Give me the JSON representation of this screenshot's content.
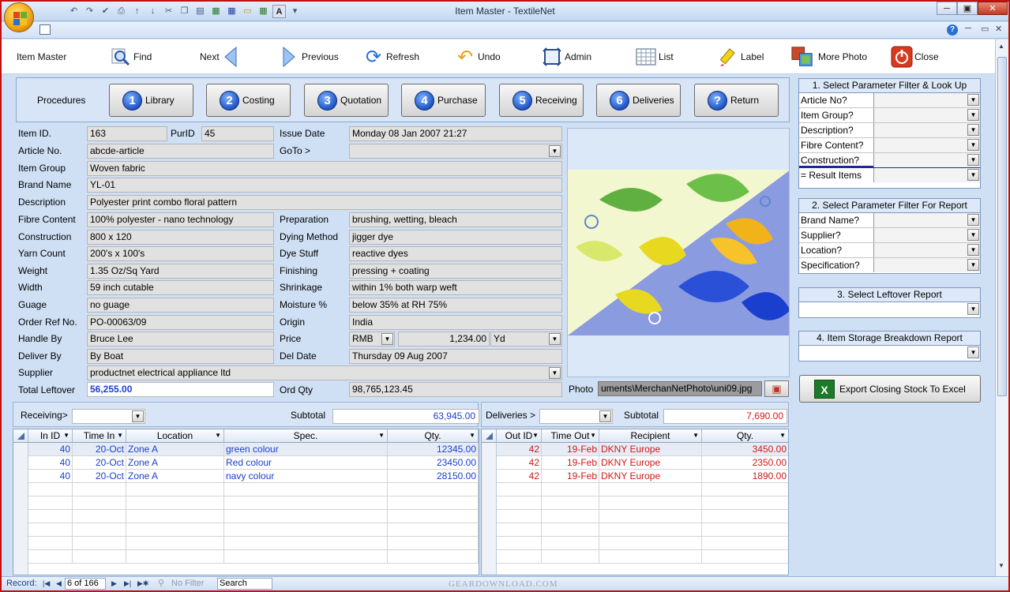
{
  "window": {
    "title": "Item Master - TextileNet",
    "help_icon": "?",
    "min": "─",
    "max": "▣",
    "close": "✕"
  },
  "toolbar": {
    "form_title": "Item Master",
    "find": "Find",
    "next": "Next",
    "previous": "Previous",
    "refresh": "Refresh",
    "undo": "Undo",
    "admin": "Admin",
    "list": "List",
    "label": "Label",
    "more_photo": "More Photo",
    "close": "Close"
  },
  "procedures": {
    "label": "Procedures",
    "buttons": [
      {
        "num": "1",
        "label": "Library"
      },
      {
        "num": "2",
        "label": "Costing"
      },
      {
        "num": "3",
        "label": "Quotation"
      },
      {
        "num": "4",
        "label": "Purchase"
      },
      {
        "num": "5",
        "label": "Receiving"
      },
      {
        "num": "6",
        "label": "Deliveries"
      },
      {
        "num": "?",
        "label": "Return"
      }
    ]
  },
  "form": {
    "item_id": {
      "label": "Item ID.",
      "value": "163"
    },
    "purid": {
      "label": "PurID",
      "value": "45"
    },
    "issue_date": {
      "label": "Issue Date",
      "value": "Monday 08 Jan 2007 21:27"
    },
    "article_no": {
      "label": "Article No.",
      "value": "abcde-article"
    },
    "goto": {
      "label": "GoTo >",
      "value": ""
    },
    "item_group": {
      "label": "Item Group",
      "value": "Woven fabric"
    },
    "brand_name": {
      "label": "Brand Name",
      "value": "YL-01"
    },
    "description": {
      "label": "Description",
      "value": "Polyester print combo floral pattern"
    },
    "fibre_content": {
      "label": "Fibre Content",
      "value": "100% polyester - nano technology"
    },
    "preparation": {
      "label": "Preparation",
      "value": "brushing, wetting, bleach"
    },
    "construction": {
      "label": "Construction",
      "value": "800 x 120"
    },
    "dying_method": {
      "label": "Dying Method",
      "value": "jigger dye"
    },
    "yarn_count": {
      "label": "Yarn Count",
      "value": "200's x 100's"
    },
    "dye_stuff": {
      "label": "Dye Stuff",
      "value": "reactive dyes"
    },
    "weight": {
      "label": "Weight",
      "value": "1.35 Oz/Sq Yard"
    },
    "finishing": {
      "label": "Finishing",
      "value": "pressing + coating"
    },
    "width": {
      "label": "Width",
      "value": "59 inch cutable"
    },
    "shrinkage": {
      "label": "Shrinkage",
      "value": "within 1% both warp weft"
    },
    "guage": {
      "label": "Guage",
      "value": "no guage"
    },
    "moisture": {
      "label": "Moisture %",
      "value": "below 35% at RH 75%"
    },
    "order_ref": {
      "label": "Order Ref No.",
      "value": "PO-00063/09"
    },
    "origin": {
      "label": "Origin",
      "value": "India"
    },
    "handle_by": {
      "label": "Handle By",
      "value": "Bruce Lee"
    },
    "price": {
      "label": "Price",
      "currency": "RMB",
      "value": "1,234.00",
      "unit": "Yd"
    },
    "deliver_by": {
      "label": "Deliver By",
      "value": "By Boat"
    },
    "del_date": {
      "label": "Del Date",
      "value": "Thursday 09 Aug 2007"
    },
    "supplier": {
      "label": "Supplier",
      "value": "productnet electrical appliance ltd"
    },
    "total_leftover": {
      "label": "Total Leftover",
      "value": "56,255.00"
    },
    "ord_qty": {
      "label": "Ord Qty",
      "value": "98,765,123.45"
    },
    "photo": {
      "label": "Photo",
      "value": "uments\\MerchanNetPhoto\\uni09.jpg"
    }
  },
  "right_panel": {
    "lookup": {
      "title": "1. Select Parameter Filter & Look Up",
      "rows": [
        "Article No?",
        "Item Group?",
        "Description?",
        "Fibre Content?",
        "Construction?"
      ],
      "result": "= Result Items"
    },
    "report": {
      "title": "2. Select Parameter Filter For Report",
      "rows": [
        "Brand Name?",
        "Supplier?",
        "Location?",
        "Specification?"
      ]
    },
    "leftover": {
      "title": "3. Select Leftover Report"
    },
    "storage": {
      "title": "4. Item Storage Breakdown Report"
    },
    "export": "Export Closing Stock To Excel"
  },
  "receiving": {
    "label": "Receiving>",
    "subtotal_label": "Subtotal",
    "subtotal": "63,945.00",
    "columns": [
      "In ID",
      "Time In",
      "Location",
      "Spec.",
      "Qty."
    ],
    "rows": [
      [
        "40",
        "20-Oct",
        "Zone A",
        "green colour",
        "12345.00"
      ],
      [
        "40",
        "20-Oct",
        "Zone A",
        "Red colour",
        "23450.00"
      ],
      [
        "40",
        "20-Oct",
        "Zone A",
        "navy colour",
        "28150.00"
      ]
    ]
  },
  "deliveries": {
    "label": "Deliveries >",
    "subtotal_label": "Subtotal",
    "subtotal": "7,690.00",
    "columns": [
      "Out ID",
      "Time Out",
      "Recipient",
      "Qty."
    ],
    "rows": [
      [
        "42",
        "19-Feb",
        "DKNY Europe",
        "3450.00"
      ],
      [
        "42",
        "19-Feb",
        "DKNY Europe",
        "2350.00"
      ],
      [
        "42",
        "19-Feb",
        "DKNY Europe",
        "1890.00"
      ]
    ]
  },
  "statusbar": {
    "record_label": "Record:",
    "record_value": "6 of 166",
    "no_filter": "No Filter",
    "search": "Search",
    "watermark": "GEARDOWNLOAD.COM"
  },
  "colors": {
    "accent": "#1a3fcf",
    "delivery_red": "#d01818",
    "window_border": "#c01010"
  }
}
